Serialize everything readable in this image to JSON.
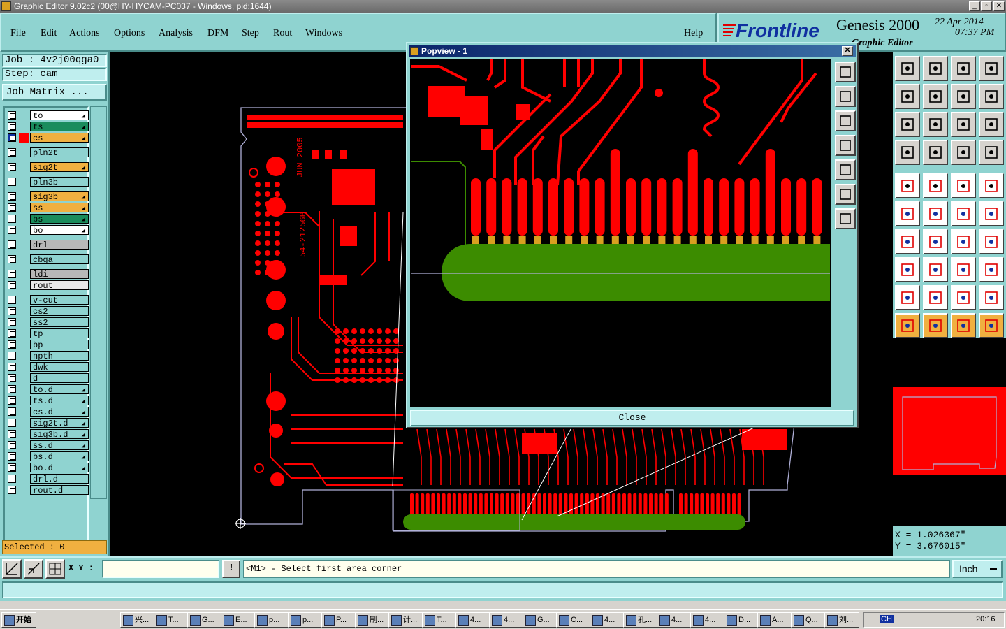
{
  "window": {
    "title": "Graphic Editor 9.02c2 (00@HY-HYCAM-PC037 - Windows, pid:1644)",
    "minimize": "_",
    "restore": "▫",
    "close": "✕"
  },
  "menu": {
    "items": [
      "File",
      "Edit",
      "Actions",
      "Options",
      "Analysis",
      "DFM",
      "Step",
      "Rout",
      "Windows"
    ],
    "help": "Help"
  },
  "brand": {
    "logo": "Frontline",
    "product": "Genesis 2000",
    "subtitle": "Graphic Editor",
    "date": "22 Apr 2014",
    "time": "07:37 PM"
  },
  "job": {
    "job_label": "Job : 4v2j00qga0",
    "step_label": "Step: cam",
    "matrix_button": "Job Matrix ...",
    "selected": "Selected : 0"
  },
  "layers": [
    {
      "name": "to",
      "color": "#ffffff",
      "arrow": true,
      "group": 1
    },
    {
      "name": "ts",
      "color": "#1a8c5c",
      "arrow": true,
      "group": 1
    },
    {
      "name": "cs",
      "color": "#f0b040",
      "arrow": true,
      "group": 1,
      "active": true
    },
    {
      "name": "pln2t",
      "color": "#8fd3d0",
      "arrow": false,
      "group": 2
    },
    {
      "name": "sig2t",
      "color": "#f0b040",
      "arrow": true,
      "group": 3
    },
    {
      "name": "pln3b",
      "color": "#8fd3d0",
      "arrow": false,
      "group": 4
    },
    {
      "name": "sig3b",
      "color": "#f0b040",
      "arrow": true,
      "group": 5
    },
    {
      "name": "ss",
      "color": "#f0b040",
      "arrow": true,
      "group": 5
    },
    {
      "name": "bs",
      "color": "#1a8c5c",
      "arrow": true,
      "group": 5
    },
    {
      "name": "bo",
      "color": "#ffffff",
      "arrow": true,
      "group": 5
    },
    {
      "name": "drl",
      "color": "#b8b8b8",
      "arrow": false,
      "group": 6
    },
    {
      "name": "cbga",
      "color": "#8fd3d0",
      "arrow": false,
      "group": 7
    },
    {
      "name": "ldi",
      "color": "#b8b8b8",
      "arrow": false,
      "group": 8
    },
    {
      "name": "rout",
      "color": "#e8e8e8",
      "arrow": false,
      "group": 8
    },
    {
      "name": "v-cut",
      "color": "#8fd3d0",
      "arrow": false,
      "group": 9
    },
    {
      "name": "cs2",
      "color": "#8fd3d0",
      "arrow": false,
      "group": 9
    },
    {
      "name": "ss2",
      "color": "#8fd3d0",
      "arrow": false,
      "group": 9
    },
    {
      "name": "tp",
      "color": "#8fd3d0",
      "arrow": false,
      "group": 9
    },
    {
      "name": "bp",
      "color": "#8fd3d0",
      "arrow": false,
      "group": 9
    },
    {
      "name": "npth",
      "color": "#8fd3d0",
      "arrow": false,
      "group": 9
    },
    {
      "name": "dwk",
      "color": "#8fd3d0",
      "arrow": false,
      "group": 9
    },
    {
      "name": "d",
      "color": "#8fd3d0",
      "arrow": false,
      "group": 9
    },
    {
      "name": "to.d",
      "color": "#8fd3d0",
      "arrow": true,
      "group": 9
    },
    {
      "name": "ts.d",
      "color": "#8fd3d0",
      "arrow": true,
      "group": 9
    },
    {
      "name": "cs.d",
      "color": "#8fd3d0",
      "arrow": true,
      "group": 9
    },
    {
      "name": "sig2t.d",
      "color": "#8fd3d0",
      "arrow": true,
      "group": 9
    },
    {
      "name": "sig3b.d",
      "color": "#8fd3d0",
      "arrow": true,
      "group": 9
    },
    {
      "name": "ss.d",
      "color": "#8fd3d0",
      "arrow": true,
      "group": 9
    },
    {
      "name": "bs.d",
      "color": "#8fd3d0",
      "arrow": true,
      "group": 9
    },
    {
      "name": "bo.d",
      "color": "#8fd3d0",
      "arrow": true,
      "group": 9
    },
    {
      "name": "drl.d",
      "color": "#8fd3d0",
      "arrow": false,
      "group": 9
    },
    {
      "name": "rout.d",
      "color": "#8fd3d0",
      "arrow": false,
      "group": 9
    }
  ],
  "board": {
    "text1": "JUN 2005",
    "text2": "54-21256B"
  },
  "popup": {
    "title": "Popview - 1",
    "close_x": "✕",
    "close_button": "Close"
  },
  "coords": {
    "x": "X = 1.026367\"",
    "y": "Y = 3.676015\""
  },
  "bottom": {
    "xy_label": "X Y :",
    "xy_value": "",
    "warn": "!",
    "prompt": "<M1> - Select first area corner",
    "units": "Inch"
  },
  "taskbar": {
    "start": "开始",
    "tasks": [
      "兴...",
      "T...",
      "G...",
      "E...",
      "p...",
      "p...",
      "P...",
      "制...",
      "计...",
      "T...",
      "4...",
      "4...",
      "G...",
      "C...",
      "4...",
      "孔...",
      "4...",
      "4...",
      "D...",
      "A...",
      "Q...",
      "刘..."
    ],
    "lang": "CH",
    "clock": "20:16"
  },
  "colors": {
    "panel": "#8fd3d0",
    "copper": "#ff0000",
    "soldermask": "#3c8c00",
    "outline": "#b0b0d8",
    "highlight": "#f0b040"
  }
}
